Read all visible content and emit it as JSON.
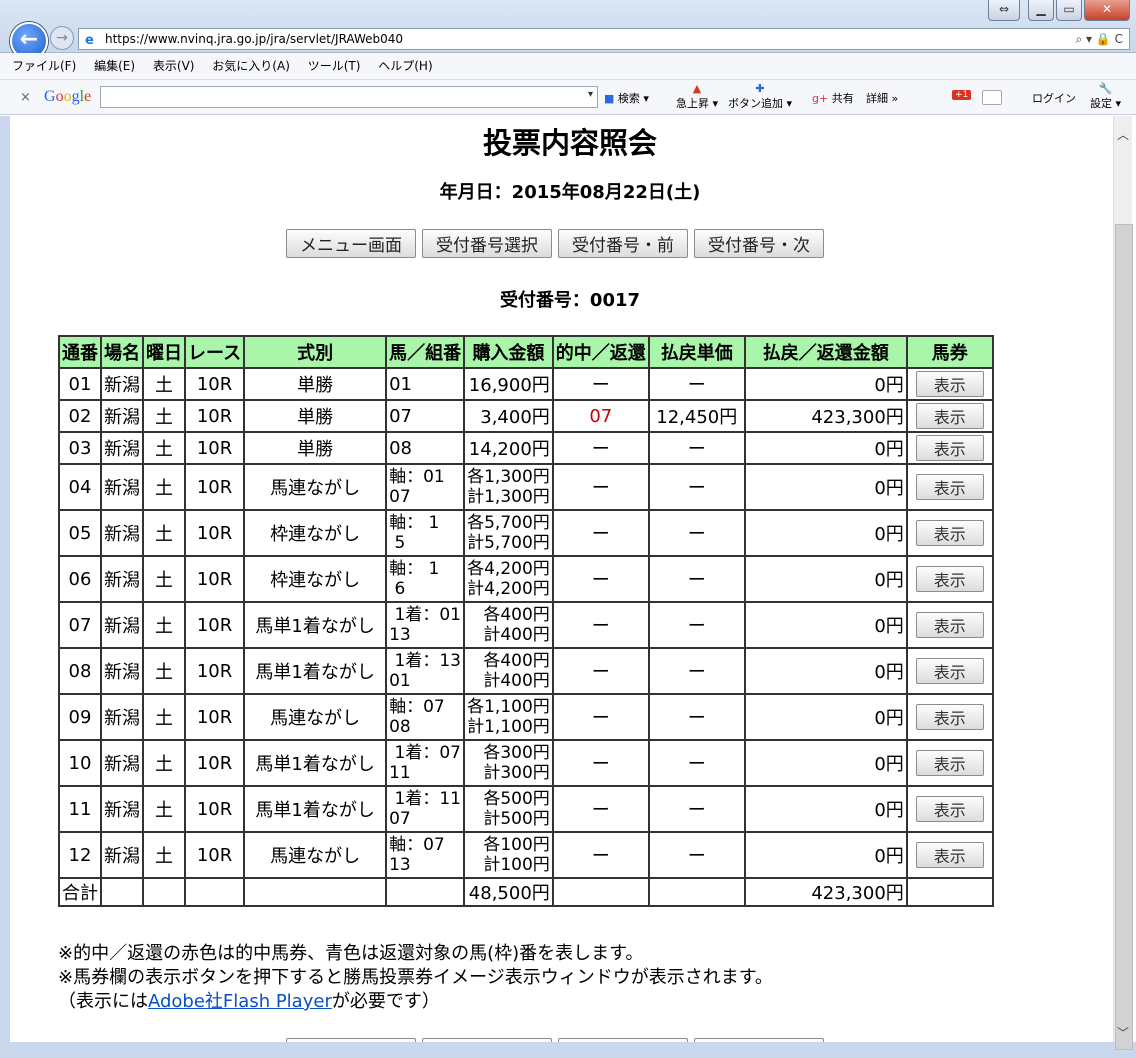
{
  "browser": {
    "url": "https://www.nvinq.jra.go.jp/jra/servlet/JRAWeb040",
    "menu": [
      "ファイル(F)",
      "編集(E)",
      "表示(V)",
      "お気に入り(A)",
      "ツール(T)",
      "ヘルプ(H)"
    ],
    "google": {
      "logo": "Google",
      "search": "検索",
      "jump": "急上昇",
      "add": "ボタン追加",
      "share": "共有",
      "detail": "詳細",
      "login": "ログイン",
      "settings": "設定",
      "g1": "+1"
    }
  },
  "page": {
    "title": "投票内容照会",
    "date": "年月日：2015年08月22日(土)",
    "buttons": {
      "menu": "メニュー画面",
      "select": "受付番号選択",
      "prev": "受付番号・前",
      "next": "受付番号・次"
    },
    "receipt": "受付番号：0017"
  },
  "table": {
    "headers": [
      "通番",
      "場名",
      "曜日",
      "レース",
      "式別",
      "馬／組番",
      "購入金額",
      "的中／返還",
      "払戻単価",
      "払戻／返還金額",
      "馬券"
    ],
    "rows": [
      {
        "no": "01",
        "place": "新潟",
        "day": "土",
        "race": "10R",
        "type": "単勝",
        "combo1": "01",
        "combo2": "",
        "amt1": "16,900円",
        "amt2": "",
        "hit": "ー",
        "unit": "ー",
        "pay": "0円",
        "btn": "表示"
      },
      {
        "no": "02",
        "place": "新潟",
        "day": "土",
        "race": "10R",
        "type": "単勝",
        "combo1": "07",
        "combo2": "",
        "amt1": "3,400円",
        "amt2": "",
        "hit": "07",
        "unit": "12,450円",
        "pay": "423,300円",
        "btn": "表示"
      },
      {
        "no": "03",
        "place": "新潟",
        "day": "土",
        "race": "10R",
        "type": "単勝",
        "combo1": "08",
        "combo2": "",
        "amt1": "14,200円",
        "amt2": "",
        "hit": "ー",
        "unit": "ー",
        "pay": "0円",
        "btn": "表示"
      },
      {
        "no": "04",
        "place": "新潟",
        "day": "土",
        "race": "10R",
        "type": "馬連ながし",
        "combo1": "軸：01",
        "combo2": "07",
        "amt1": "各1,300円",
        "amt2": "計1,300円",
        "hit": "ー",
        "unit": "ー",
        "pay": "0円",
        "btn": "表示"
      },
      {
        "no": "05",
        "place": "新潟",
        "day": "土",
        "race": "10R",
        "type": "枠連ながし",
        "combo1": "軸： 1",
        "combo2": " 5",
        "amt1": "各5,700円",
        "amt2": "計5,700円",
        "hit": "ー",
        "unit": "ー",
        "pay": "0円",
        "btn": "表示"
      },
      {
        "no": "06",
        "place": "新潟",
        "day": "土",
        "race": "10R",
        "type": "枠連ながし",
        "combo1": "軸： 1",
        "combo2": " 6",
        "amt1": "各4,200円",
        "amt2": "計4,200円",
        "hit": "ー",
        "unit": "ー",
        "pay": "0円",
        "btn": "表示"
      },
      {
        "no": "07",
        "place": "新潟",
        "day": "土",
        "race": "10R",
        "type": "馬単1着ながし",
        "combo1": " 1着：01",
        "combo2": "13",
        "amt1": "各400円",
        "amt2": "計400円",
        "hit": "ー",
        "unit": "ー",
        "pay": "0円",
        "btn": "表示"
      },
      {
        "no": "08",
        "place": "新潟",
        "day": "土",
        "race": "10R",
        "type": "馬単1着ながし",
        "combo1": " 1着：13",
        "combo2": "01",
        "amt1": "各400円",
        "amt2": "計400円",
        "hit": "ー",
        "unit": "ー",
        "pay": "0円",
        "btn": "表示"
      },
      {
        "no": "09",
        "place": "新潟",
        "day": "土",
        "race": "10R",
        "type": "馬連ながし",
        "combo1": "軸：07",
        "combo2": "08",
        "amt1": "各1,100円",
        "amt2": "計1,100円",
        "hit": "ー",
        "unit": "ー",
        "pay": "0円",
        "btn": "表示"
      },
      {
        "no": "10",
        "place": "新潟",
        "day": "土",
        "race": "10R",
        "type": "馬単1着ながし",
        "combo1": " 1着：07",
        "combo2": "11",
        "amt1": "各300円",
        "amt2": "計300円",
        "hit": "ー",
        "unit": "ー",
        "pay": "0円",
        "btn": "表示"
      },
      {
        "no": "11",
        "place": "新潟",
        "day": "土",
        "race": "10R",
        "type": "馬単1着ながし",
        "combo1": " 1着：11",
        "combo2": "07",
        "amt1": "各500円",
        "amt2": "計500円",
        "hit": "ー",
        "unit": "ー",
        "pay": "0円",
        "btn": "表示"
      },
      {
        "no": "12",
        "place": "新潟",
        "day": "土",
        "race": "10R",
        "type": "馬連ながし",
        "combo1": "軸：07",
        "combo2": "13",
        "amt1": "各100円",
        "amt2": "計100円",
        "hit": "ー",
        "unit": "ー",
        "pay": "0円",
        "btn": "表示"
      }
    ],
    "total": {
      "label": "合計",
      "amount": "48,500円",
      "pay": "423,300円"
    }
  },
  "notes": {
    "line1": "※的中／返還の赤色は的中馬券、青色は返還対象の馬(枠)番を表します。",
    "line2": "※馬券欄の表示ボタンを押下すると勝馬投票券イメージ表示ウィンドウが表示されます。",
    "line3_pre": "（表示には",
    "line3_link": "Adobe社Flash Player",
    "line3_post": "が必要です）"
  },
  "colors": {
    "header_bg": "#a9f5a9",
    "hit": "#cc0000",
    "link": "#0a4fc4"
  }
}
